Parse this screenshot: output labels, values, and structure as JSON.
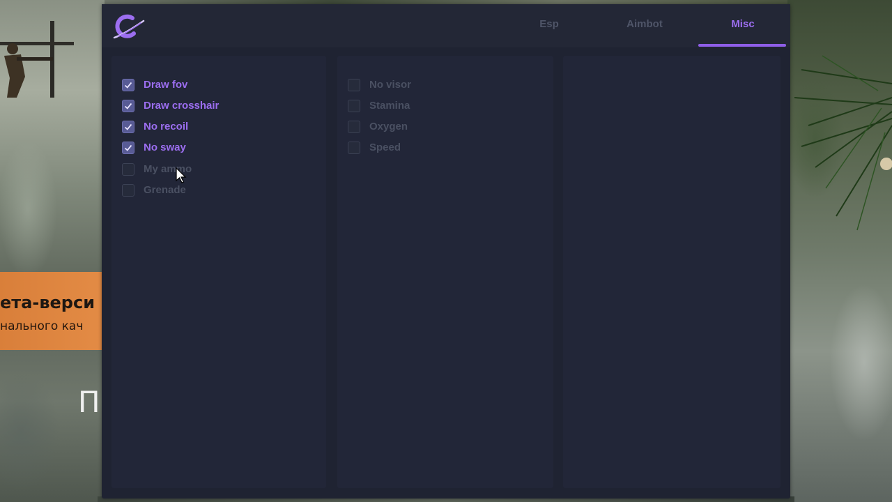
{
  "background": {
    "banner_title": "ета-верси",
    "banner_subtitle": "нального кач",
    "glyph": "П"
  },
  "tabs": [
    {
      "label": "Esp",
      "active": false
    },
    {
      "label": "Aimbot",
      "active": false
    },
    {
      "label": "Misc",
      "active": true
    }
  ],
  "columns": {
    "left": [
      {
        "label": "Draw fov",
        "checked": true
      },
      {
        "label": "Draw crosshair",
        "checked": true
      },
      {
        "label": "No recoil",
        "checked": true
      },
      {
        "label": "No sway",
        "checked": true
      },
      {
        "label": "My ammo",
        "checked": false
      },
      {
        "label": "Grenade",
        "checked": false
      }
    ],
    "middle": [
      {
        "label": "No visor",
        "checked": false
      },
      {
        "label": "Stamina",
        "checked": false
      },
      {
        "label": "Oxygen",
        "checked": false
      },
      {
        "label": "Speed",
        "checked": false
      }
    ]
  },
  "colors": {
    "accent": "#9c6ef0",
    "window": "#1f2332",
    "panel": "#222638",
    "inactive_text": "#4f5568"
  }
}
